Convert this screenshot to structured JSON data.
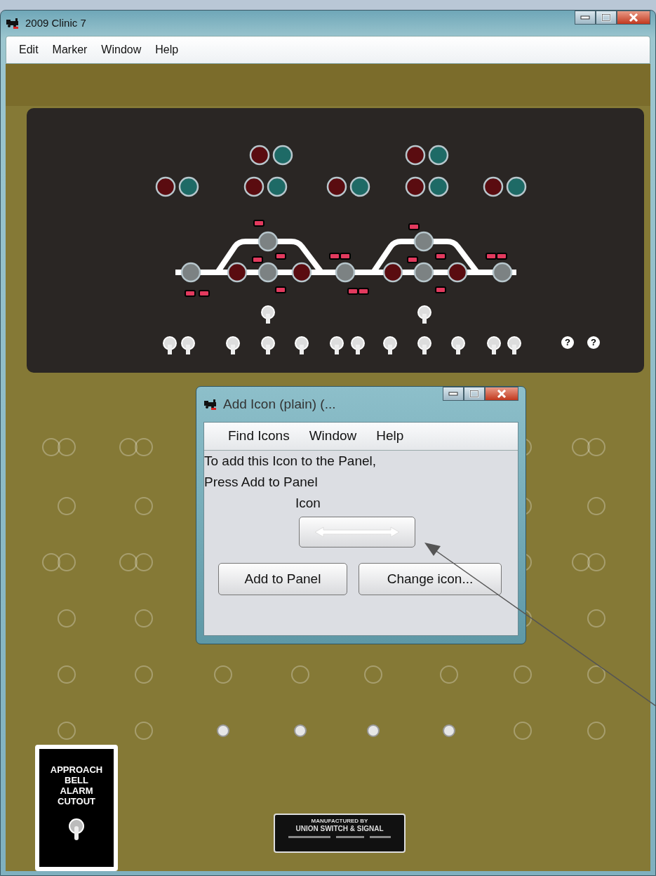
{
  "window": {
    "title": "2009 Clinic 7"
  },
  "menu": [
    "Edit",
    "Marker",
    "Window",
    "Help"
  ],
  "panel": {
    "help_markers": [
      "?",
      "?"
    ],
    "cutout_plate": {
      "lines": [
        "APPROACH",
        "BELL",
        "ALARM",
        "CUTOUT"
      ]
    },
    "maker_plate": {
      "lines": [
        "MANUFACTURED BY",
        "UNION SWITCH & SIGNAL"
      ]
    }
  },
  "dialog": {
    "title": "Add Icon (plain) (...",
    "menu": [
      "Find Icons",
      "Window",
      "Help"
    ],
    "instructions": [
      "To add this Icon to the Panel,",
      "Press Add to Panel"
    ],
    "icon_label": "Icon",
    "buttons": [
      "Add to Panel",
      "Change icon..."
    ]
  }
}
